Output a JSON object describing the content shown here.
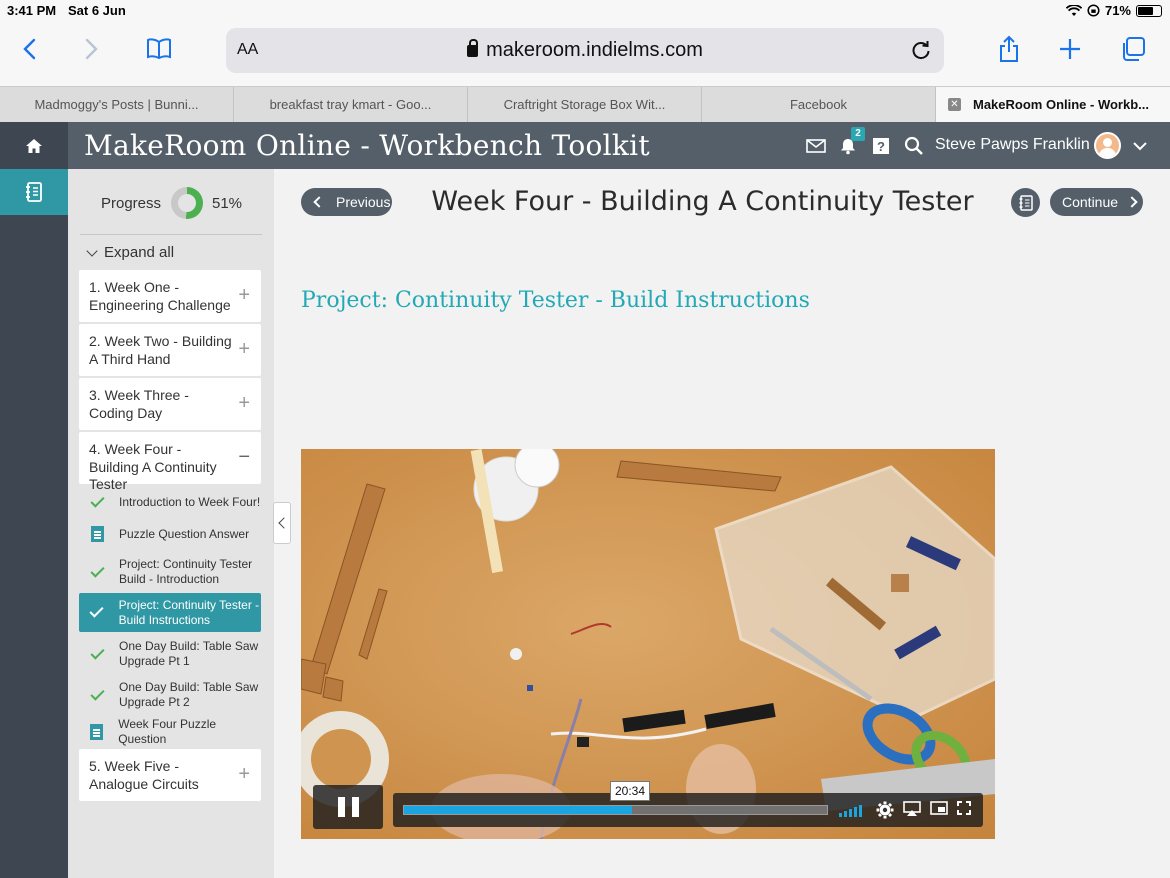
{
  "status": {
    "time": "3:41 PM",
    "date": "Sat 6 Jun",
    "battery": "71%",
    "battery_level": 0.71
  },
  "browser": {
    "text_size_label": "AA",
    "url": "makeroom.indielms.com",
    "tabs": [
      {
        "label": "Madmoggy's Posts | Bunni..."
      },
      {
        "label": "breakfast tray kmart - Goo..."
      },
      {
        "label": "Craftright Storage Box Wit..."
      },
      {
        "label": "Facebook"
      },
      {
        "label": "MakeRoom Online - Workb..."
      }
    ]
  },
  "app": {
    "title": "MakeRoom Online - Workbench Toolkit",
    "notification_count": "2",
    "user_name": "Steve Pawps Franklin"
  },
  "sidebar": {
    "progress_label": "Progress",
    "progress_value": "51%",
    "progress_fraction": 0.51,
    "expand_all": "Expand all",
    "weeks": [
      {
        "label": "1. Week One - Engineering Challenge",
        "toggle": "+"
      },
      {
        "label": "2. Week Two - Building A Third Hand",
        "toggle": "+"
      },
      {
        "label": "3. Week Three - Coding Day",
        "toggle": "+"
      },
      {
        "label": "4. Week Four - Building A Continuity Tester",
        "toggle": "−"
      },
      {
        "label": "5. Week Five - Analogue Circuits",
        "toggle": "+"
      }
    ],
    "items": [
      {
        "label": "Introduction to Week Four!",
        "icon": "check-icon"
      },
      {
        "label": "Puzzle Question Answer",
        "icon": "document-icon"
      },
      {
        "label": "Project: Continuity Tester Build - Introduction",
        "icon": "check-icon"
      },
      {
        "label": "Project: Continuity Tester - Build Instructions",
        "icon": "check-icon",
        "active": true
      },
      {
        "label": "One Day Build: Table Saw Upgrade Pt 1",
        "icon": "check-icon"
      },
      {
        "label": "One Day Build: Table Saw Upgrade Pt 2",
        "icon": "check-icon"
      },
      {
        "label": "Week Four Puzzle Question",
        "icon": "document-icon"
      }
    ]
  },
  "main": {
    "previous_label": "Previous",
    "continue_label": "Continue",
    "page_title": "Week Four - Building A Continuity Tester",
    "section_title": "Project: Continuity Tester - Build Instructions"
  },
  "video": {
    "time_tooltip": "20:34",
    "progress_fraction": 0.54
  },
  "colors": {
    "accent": "#2f98a4",
    "header": "#545f6a",
    "rail": "#3d4651",
    "link": "#22a9b5",
    "video_progress": "#1aa5e0"
  }
}
